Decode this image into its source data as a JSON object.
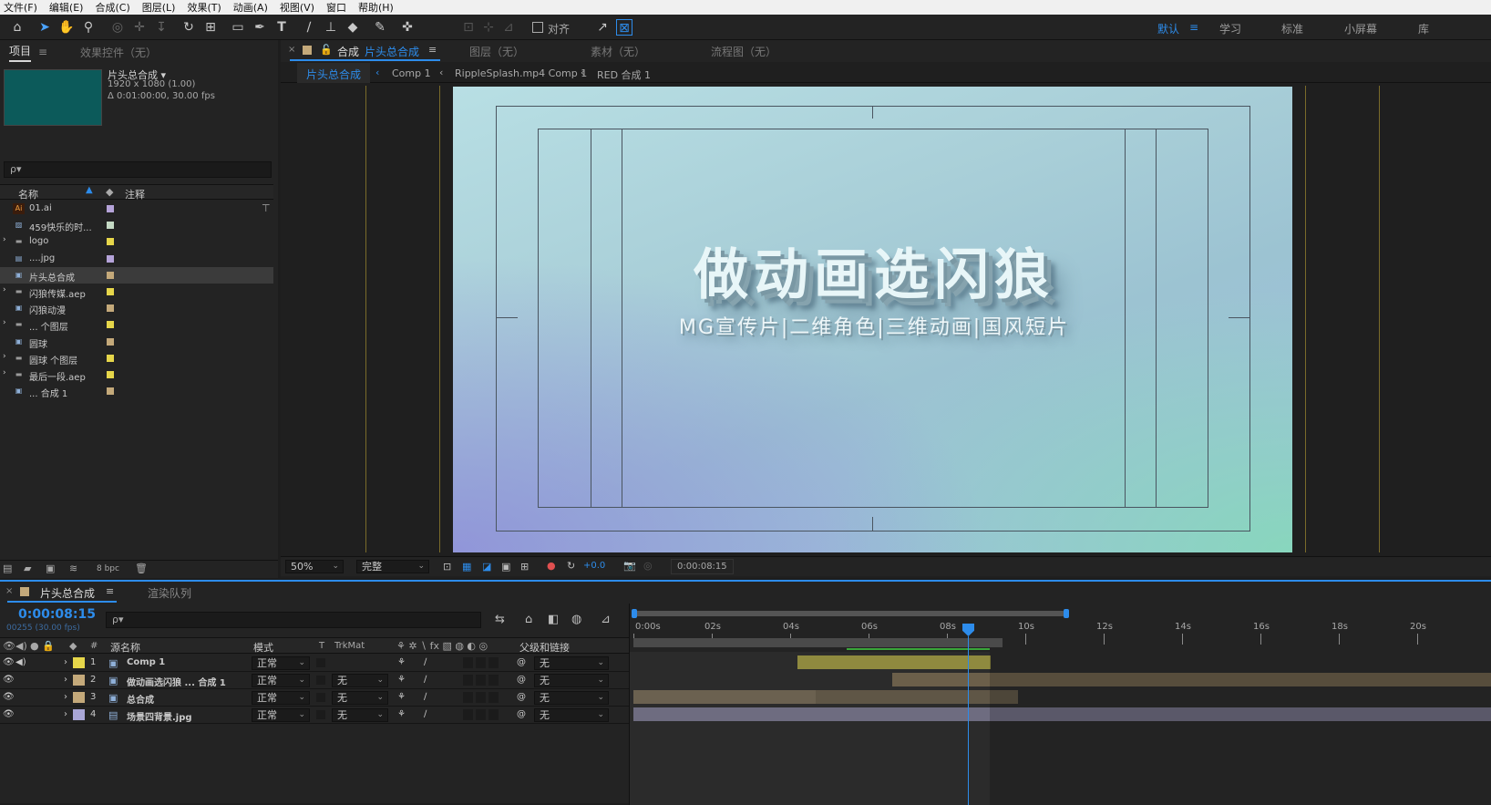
{
  "menu": [
    "文件(F)",
    "编辑(E)",
    "合成(C)",
    "图层(L)",
    "效果(T)",
    "动画(A)",
    "视图(V)",
    "窗口",
    "帮助(H)"
  ],
  "toolbar": {
    "align_label": "对齐",
    "workspaces": [
      "默认",
      "学习",
      "标准",
      "小屏幕",
      "库"
    ]
  },
  "project_panel": {
    "tab_project": "项目",
    "tab_effects": "效果控件（无）",
    "comp_name": "片头总合成",
    "comp_res": "1920 x 1080 (1.00)",
    "comp_dur": "Δ 0:01:00:00, 30.00 fps",
    "thumb_color": "#0c5a5a",
    "search_placeholder": "ρ▾",
    "col_name": "名称",
    "col_comment": "注释",
    "bpc": "8 bpc",
    "items": [
      {
        "name": "01.ai",
        "icon": "ai-file-icon",
        "color": "#b5a3d9"
      },
      {
        "name": "459快乐的时...",
        "icon": "image-file-icon",
        "color": "#c4d9c4"
      },
      {
        "name": "logo",
        "icon": "folder-icon",
        "color": "#e6d64a"
      },
      {
        "name": "....jpg",
        "icon": "jpg-file-icon",
        "color": "#b5a3d9"
      },
      {
        "name": "片头总合成",
        "icon": "composition-icon",
        "color": "#c4a97a"
      },
      {
        "name": "闪狼传媒.aep",
        "icon": "folder-icon",
        "color": "#e6d64a"
      },
      {
        "name": "闪狼动漫",
        "icon": "composition-icon",
        "color": "#c4a97a"
      },
      {
        "name": "... 个图层",
        "icon": "folder-icon",
        "color": "#e6d64a"
      },
      {
        "name": "圆球",
        "icon": "composition-icon",
        "color": "#c4a97a"
      },
      {
        "name": "圆球 个图层",
        "icon": "folder-icon",
        "color": "#e6d64a"
      },
      {
        "name": "最后一段.aep",
        "icon": "folder-icon",
        "color": "#e6d64a"
      },
      {
        "name": "... 合成 1",
        "icon": "composition-icon",
        "color": "#c4a97a"
      }
    ]
  },
  "comp_panel": {
    "tab_prefix": "合成",
    "tab_comp": "片头总合成",
    "tab_layer": "图层（无）",
    "tab_footage": "素材（无）",
    "tab_flow": "流程图（无）",
    "breadcrumbs": [
      "片头总合成",
      "Comp 1",
      "RippleSplash.mp4 Comp 1",
      "RED 合成 1"
    ],
    "title_text": "做动画选闪狼",
    "subtitle_text": "MG宣传片|二维角色|三维动画|国风短片",
    "zoom": "50%",
    "quality": "完整",
    "exposure": "+0.0",
    "timecode": "0:00:08:15"
  },
  "timeline": {
    "tab_comp": "片头总合成",
    "tab_render": "渲染队列",
    "timecode": "0:00:08:15",
    "frames": "00255 (30.00 fps)",
    "search_placeholder": "ρ▾",
    "col_num": "#",
    "col_source": "源名称",
    "col_mode": "模式",
    "col_t": "T",
    "col_trkmat": "TrkMat",
    "col_parent": "父级和链接",
    "ruler": [
      "0:00s",
      "02s",
      "04s",
      "06s",
      "08s",
      "10s",
      "12s",
      "14s",
      "16s",
      "18s",
      "20s"
    ],
    "layers": [
      {
        "num": "1",
        "name": "Comp 1",
        "color": "#e6d64a",
        "icon": "composition-icon",
        "mode": "正常",
        "trkmat": "",
        "parent": "无",
        "audio": true
      },
      {
        "num": "2",
        "name": "做动画选闪狼 ... 合成 1",
        "color": "#c4a97a",
        "icon": "composition-icon",
        "mode": "正常",
        "trkmat": "无",
        "parent": "无",
        "audio": false
      },
      {
        "num": "3",
        "name": "总合成",
        "color": "#c4a97a",
        "icon": "composition-icon",
        "mode": "正常",
        "trkmat": "无",
        "parent": "无",
        "audio": false
      },
      {
        "num": "4",
        "name": "场景四背景.jpg",
        "color": "#a9a6d6",
        "icon": "jpg-file-icon",
        "mode": "正常",
        "trkmat": "无",
        "parent": "无",
        "audio": false
      }
    ]
  }
}
